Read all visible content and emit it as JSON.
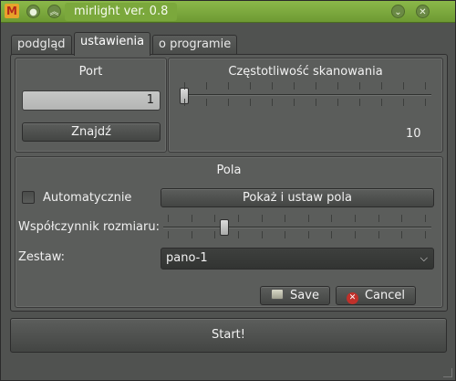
{
  "window": {
    "title": "mirlight ver. 0.8",
    "logo_letter": "M"
  },
  "icons": {
    "logo": "app-logo-icon",
    "minimize": "minimize-icon",
    "keep_above": "chevrons-up-icon",
    "menu": "chevron-down-icon",
    "close": "close-icon",
    "save": "save-icon",
    "cancel": "cancel-icon"
  },
  "tabs": [
    {
      "label": "podgląd",
      "active": false
    },
    {
      "label": "ustawienia",
      "active": true
    },
    {
      "label": "o programie",
      "active": false
    }
  ],
  "port": {
    "title": "Port",
    "value": "1",
    "find_label": "Znajdź"
  },
  "scan": {
    "title": "Częstotliwość skanowania",
    "value_label": "10",
    "slider_fraction": 0.0
  },
  "fields": {
    "title": "Pola",
    "auto_label": "Automatycznie",
    "auto_checked": false,
    "show_button_label": "Pokaż i ustaw pola",
    "size_factor_label": "Współczynnik rozmiaru:",
    "size_factor_fraction": 0.22,
    "set_label": "Zestaw:",
    "set_value": "pano-1"
  },
  "actions": {
    "save_label": "Save",
    "cancel_label": "Cancel",
    "start_label": "Start!"
  },
  "colors": {
    "titlebar": "#7ba83c",
    "window_bg": "#595b59",
    "logo_bg": "#e8a32a",
    "cancel_icon": "#c0302a"
  }
}
